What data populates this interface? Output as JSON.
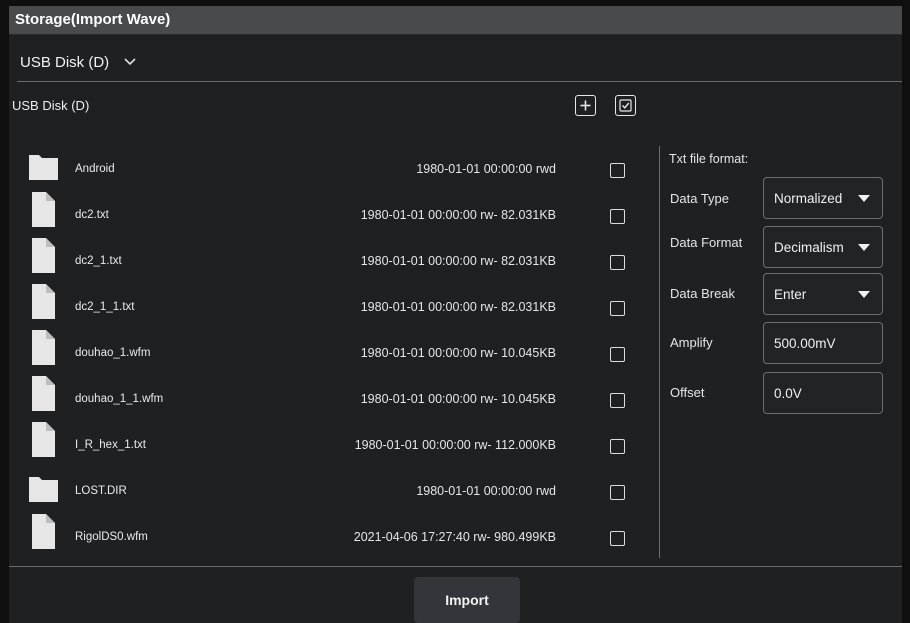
{
  "window": {
    "title": "Storage(Import Wave)"
  },
  "drive_select": {
    "value": "USB Disk (D)",
    "icon": "chevron-down-icon"
  },
  "path": "USB Disk (D)",
  "toolbar": {
    "new_folder_icon": "new-folder-icon",
    "select_all_icon": "select-all-icon"
  },
  "files": [
    {
      "name": "Android",
      "meta": "1980-01-01 00:00:00 rwd",
      "type": "folder",
      "checked": false
    },
    {
      "name": "dc2.txt",
      "meta": "1980-01-01 00:00:00 rw- 82.031KB",
      "type": "file",
      "checked": false
    },
    {
      "name": "dc2_1.txt",
      "meta": "1980-01-01 00:00:00 rw- 82.031KB",
      "type": "file",
      "checked": false
    },
    {
      "name": "dc2_1_1.txt",
      "meta": "1980-01-01 00:00:00 rw- 82.031KB",
      "type": "file",
      "checked": false
    },
    {
      "name": "douhao_1.wfm",
      "meta": "1980-01-01 00:00:00 rw- 10.045KB",
      "type": "file",
      "checked": false
    },
    {
      "name": "douhao_1_1.wfm",
      "meta": "1980-01-01 00:00:00 rw- 10.045KB",
      "type": "file",
      "checked": false
    },
    {
      "name": "I_R_hex_1.txt",
      "meta": "1980-01-01 00:00:00 rw- 112.000KB",
      "type": "file",
      "checked": false
    },
    {
      "name": "LOST.DIR",
      "meta": "1980-01-01 00:00:00 rwd",
      "type": "folder",
      "checked": false
    },
    {
      "name": "RigolDS0.wfm",
      "meta": "2021-04-06 17:27:40 rw- 980.499KB",
      "type": "file",
      "checked": false
    },
    {
      "name": "",
      "meta": "",
      "type": "folder",
      "checked": false
    }
  ],
  "options": {
    "title": "Txt file format:",
    "data_type": {
      "label": "Data Type",
      "value": "Normalized"
    },
    "data_format": {
      "label": "Data Format",
      "value": "Decimalism"
    },
    "data_break": {
      "label": "Data Break",
      "value": "Enter"
    },
    "amplify": {
      "label": "Amplify",
      "value": "500.00mV"
    },
    "offset": {
      "label": "Offset",
      "value": "0.0V"
    }
  },
  "import_label": "Import",
  "colors": {
    "background": "#1f2021",
    "titlebar": "#494a4c",
    "button": "#34353a",
    "text": "#e8e8e8"
  }
}
